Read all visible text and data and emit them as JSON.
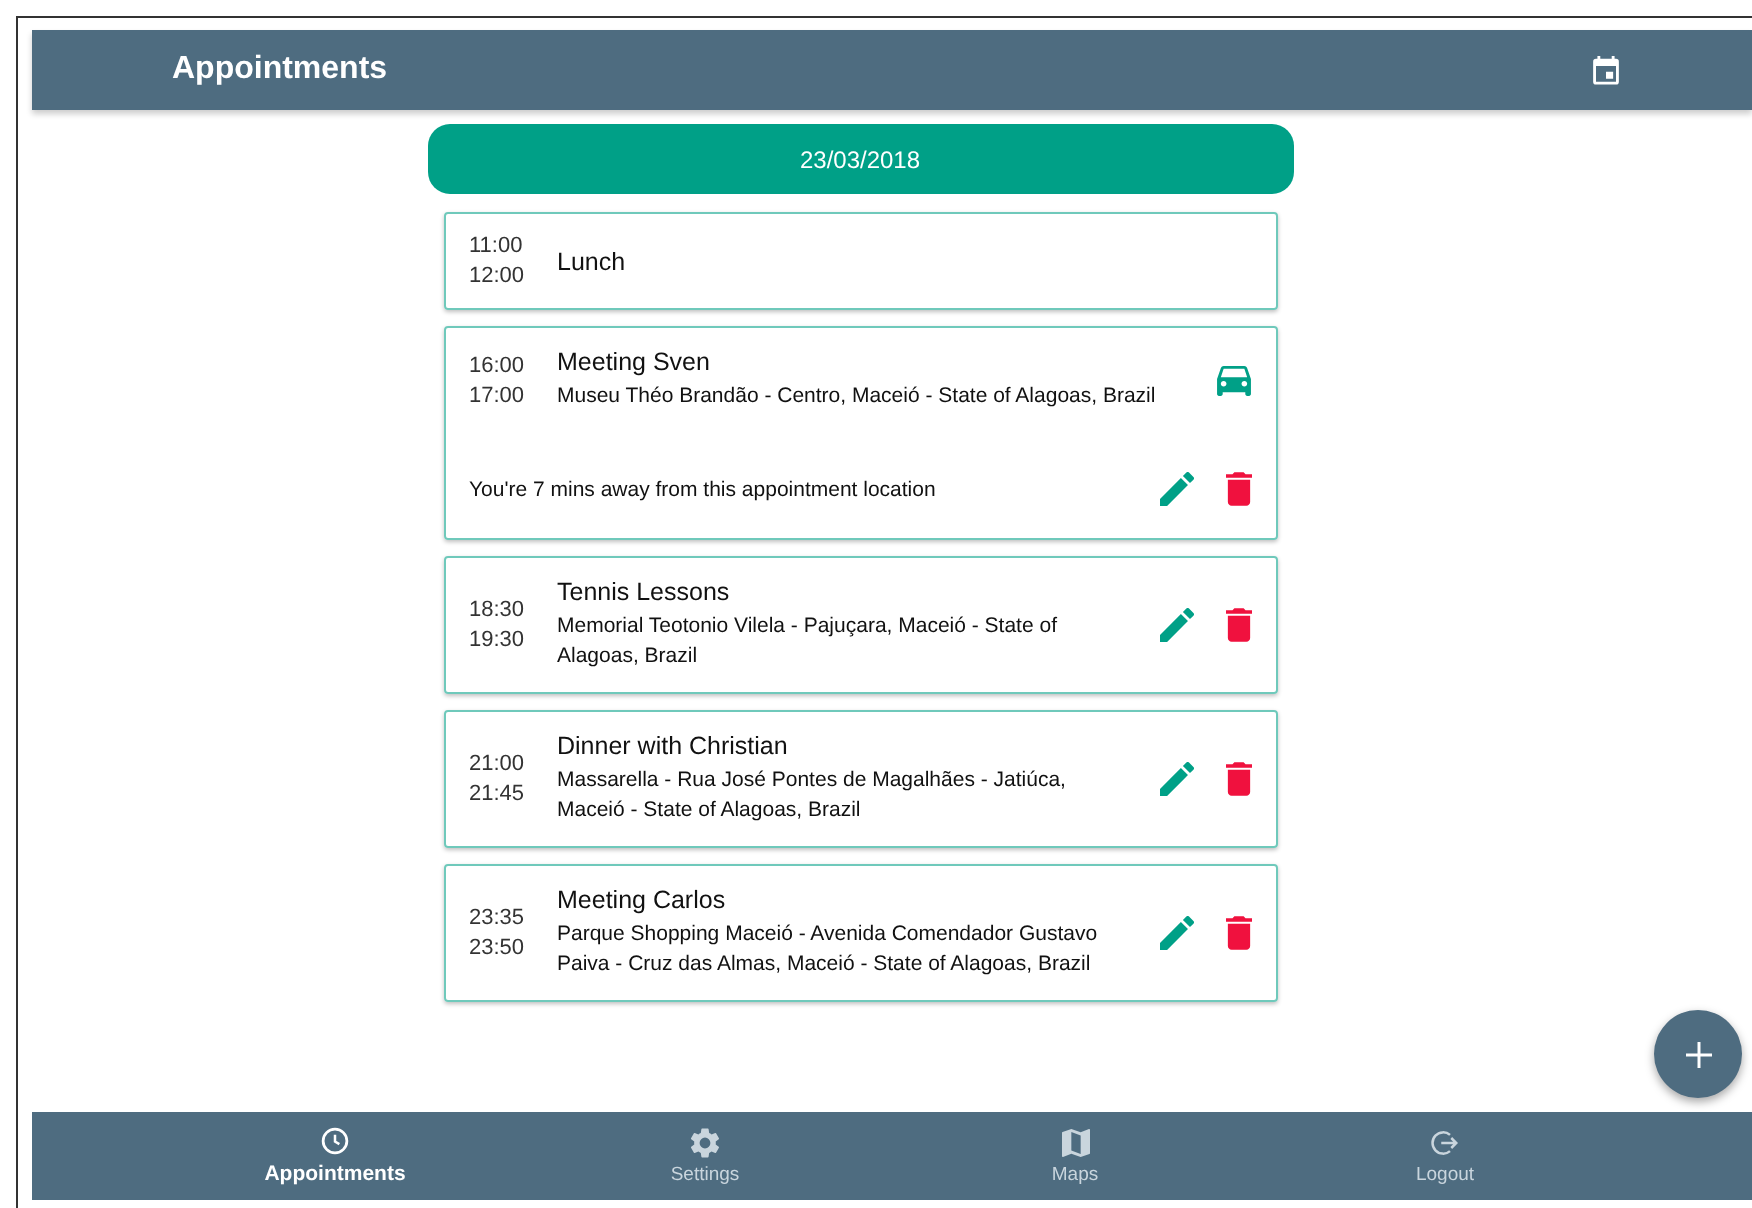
{
  "header": {
    "title": "Appointments"
  },
  "date": "23/03/2018",
  "appointments": [
    {
      "start": "11:00",
      "end": "12:00",
      "title": "Lunch",
      "actions": false,
      "car": false
    },
    {
      "start": "16:00",
      "end": "17:00",
      "title": "Meeting Sven",
      "location": "Museu Théo Brandão - Centro, Maceió - State of Alagoas, Brazil",
      "car": true,
      "travel_note": "You're 7 mins away from this appointment location",
      "actions": true
    },
    {
      "start": "18:30",
      "end": "19:30",
      "title": "Tennis Lessons",
      "location": "Memorial Teotonio Vilela - Pajuçara, Maceió - State of Alagoas, Brazil",
      "actions": true,
      "car": false
    },
    {
      "start": "21:00",
      "end": "21:45",
      "title": "Dinner with Christian",
      "location": "Massarella - Rua José Pontes de Magalhães - Jatiúca, Maceió - State of Alagoas, Brazil",
      "actions": true,
      "car": false
    },
    {
      "start": "23:35",
      "end": "23:50",
      "title": "Meeting Carlos",
      "location": "Parque Shopping Maceió - Avenida Comendador Gustavo Paiva - Cruz das Almas, Maceió - State of Alagoas, Brazil",
      "actions": true,
      "car": false
    }
  ],
  "nav": [
    {
      "kind": "clock",
      "label": "Appointments",
      "selected": true
    },
    {
      "kind": "gear",
      "label": "Settings",
      "selected": false
    },
    {
      "kind": "map",
      "label": "Maps",
      "selected": false
    },
    {
      "kind": "logout",
      "label": "Logout",
      "selected": false
    }
  ]
}
